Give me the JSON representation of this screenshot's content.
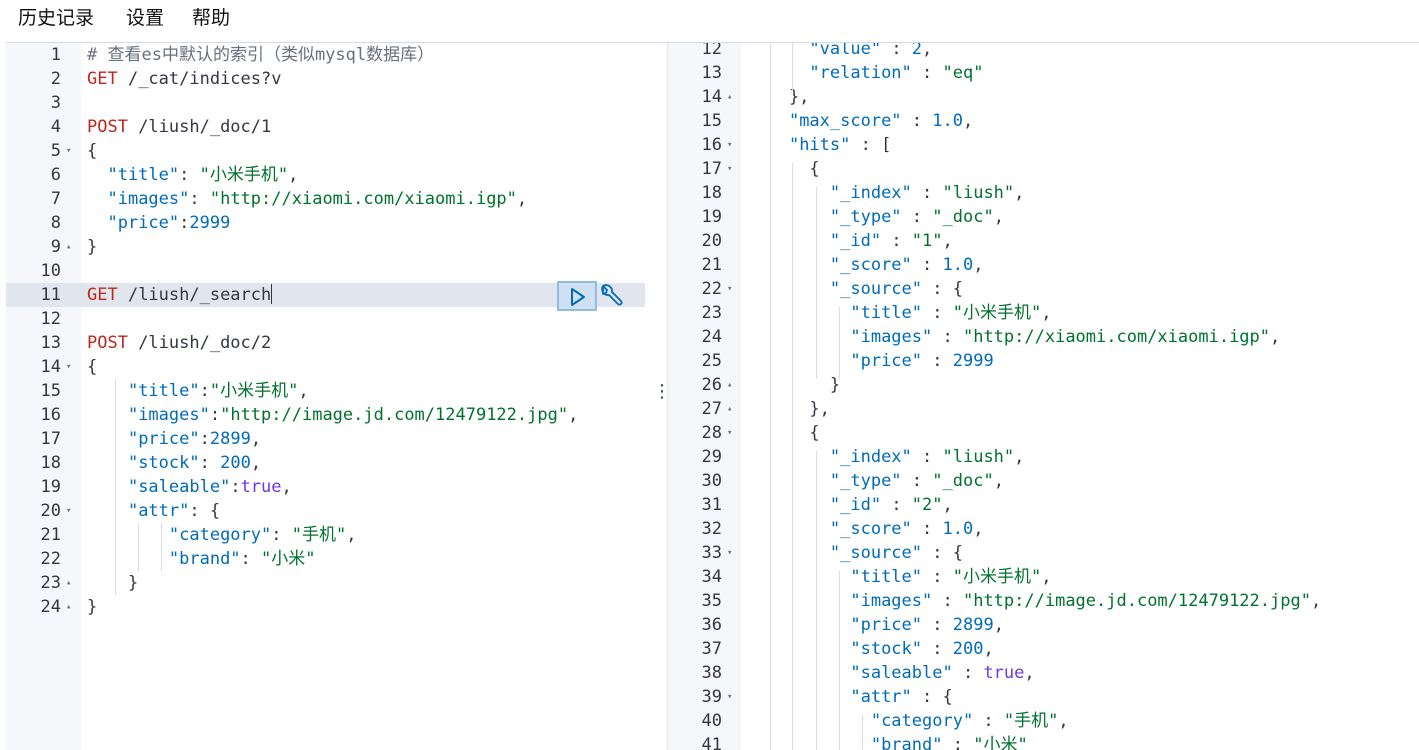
{
  "menu": [
    "历史记录",
    "设置",
    "帮助"
  ],
  "colors": {
    "string": "#00722d",
    "key": "#006bb8",
    "number": "#006bb8",
    "boolean": "#6e38e0",
    "method": "#bd271e",
    "comment": "#69707d",
    "gutter": "#f5f7fa",
    "active_line": "#e1e6ee"
  },
  "icons": {
    "run": "play-icon",
    "tools": "wrench-icon",
    "more": "kebab-menu-icon",
    "fold_open": "fold-open-icon",
    "fold_close": "fold-close-icon"
  },
  "request_editor": {
    "active_line": 11,
    "lines": [
      {
        "n": "1",
        "fold": "",
        "tokens": [
          [
            "c",
            "# 查看es中默认的索引（类似mysql数据库）"
          ]
        ]
      },
      {
        "n": "2",
        "fold": "",
        "tokens": [
          [
            "m",
            "GET"
          ],
          [
            "u",
            " /_cat/indices?v"
          ]
        ]
      },
      {
        "n": "3",
        "fold": "",
        "tokens": []
      },
      {
        "n": "4",
        "fold": "",
        "tokens": [
          [
            "m",
            "POST"
          ],
          [
            "u",
            " /liush/_doc/1"
          ]
        ]
      },
      {
        "n": "5",
        "fold": "▾",
        "tokens": [
          [
            "p",
            "{"
          ]
        ]
      },
      {
        "n": "6",
        "fold": "",
        "tokens": [
          [
            "p",
            "  "
          ],
          [
            "k",
            "\"title\""
          ],
          [
            "p",
            ": "
          ],
          [
            "s",
            "\"小米手机\""
          ],
          [
            "p",
            ","
          ]
        ]
      },
      {
        "n": "7",
        "fold": "",
        "tokens": [
          [
            "p",
            "  "
          ],
          [
            "k",
            "\"images\""
          ],
          [
            "p",
            ": "
          ],
          [
            "s",
            "\"http://xiaomi.com/xiaomi.igp\""
          ],
          [
            "p",
            ","
          ]
        ]
      },
      {
        "n": "8",
        "fold": "",
        "tokens": [
          [
            "p",
            "  "
          ],
          [
            "k",
            "\"price\""
          ],
          [
            "p",
            ":"
          ],
          [
            "n",
            "2999"
          ]
        ]
      },
      {
        "n": "9",
        "fold": "▴",
        "tokens": [
          [
            "p",
            "}"
          ]
        ]
      },
      {
        "n": "10",
        "fold": "",
        "tokens": []
      },
      {
        "n": "11",
        "fold": "",
        "tokens": [
          [
            "m",
            "GET"
          ],
          [
            "u",
            " /liush/_search"
          ]
        ]
      },
      {
        "n": "12",
        "fold": "",
        "tokens": []
      },
      {
        "n": "13",
        "fold": "",
        "tokens": [
          [
            "m",
            "POST"
          ],
          [
            "u",
            " /liush/_doc/2"
          ]
        ]
      },
      {
        "n": "14",
        "fold": "▾",
        "tokens": [
          [
            "p",
            "{"
          ]
        ]
      },
      {
        "n": "15",
        "fold": "",
        "tokens": [
          [
            "p",
            "    "
          ],
          [
            "k",
            "\"title\""
          ],
          [
            "p",
            ":"
          ],
          [
            "s",
            "\"小米手机\""
          ],
          [
            "p",
            ","
          ]
        ]
      },
      {
        "n": "16",
        "fold": "",
        "tokens": [
          [
            "p",
            "    "
          ],
          [
            "k",
            "\"images\""
          ],
          [
            "p",
            ":"
          ],
          [
            "s",
            "\"http://image.jd.com/12479122.jpg\""
          ],
          [
            "p",
            ","
          ]
        ]
      },
      {
        "n": "17",
        "fold": "",
        "tokens": [
          [
            "p",
            "    "
          ],
          [
            "k",
            "\"price\""
          ],
          [
            "p",
            ":"
          ],
          [
            "n",
            "2899"
          ],
          [
            "p",
            ","
          ]
        ]
      },
      {
        "n": "18",
        "fold": "",
        "tokens": [
          [
            "p",
            "    "
          ],
          [
            "k",
            "\"stock\""
          ],
          [
            "p",
            ": "
          ],
          [
            "n",
            "200"
          ],
          [
            "p",
            ","
          ]
        ]
      },
      {
        "n": "19",
        "fold": "",
        "tokens": [
          [
            "p",
            "    "
          ],
          [
            "k",
            "\"saleable\""
          ],
          [
            "p",
            ":"
          ],
          [
            "b",
            "true"
          ],
          [
            "p",
            ","
          ]
        ]
      },
      {
        "n": "20",
        "fold": "▾",
        "tokens": [
          [
            "p",
            "    "
          ],
          [
            "k",
            "\"attr\""
          ],
          [
            "p",
            ": {"
          ]
        ]
      },
      {
        "n": "21",
        "fold": "",
        "tokens": [
          [
            "p",
            "        "
          ],
          [
            "k",
            "\"category\""
          ],
          [
            "p",
            ": "
          ],
          [
            "s",
            "\"手机\""
          ],
          [
            "p",
            ","
          ]
        ]
      },
      {
        "n": "22",
        "fold": "",
        "tokens": [
          [
            "p",
            "        "
          ],
          [
            "k",
            "\"brand\""
          ],
          [
            "p",
            ": "
          ],
          [
            "s",
            "\"小米\""
          ]
        ]
      },
      {
        "n": "23",
        "fold": "▴",
        "tokens": [
          [
            "p",
            "    }"
          ]
        ]
      },
      {
        "n": "24",
        "fold": "▴",
        "tokens": [
          [
            "p",
            "}"
          ]
        ]
      }
    ]
  },
  "response_viewer": {
    "lines": [
      {
        "n": "12",
        "fold": "",
        "tokens": [
          [
            "p",
            "      "
          ],
          [
            "k",
            "\"value\""
          ],
          [
            "p",
            " : "
          ],
          [
            "n",
            "2"
          ],
          [
            "p",
            ","
          ]
        ]
      },
      {
        "n": "13",
        "fold": "",
        "tokens": [
          [
            "p",
            "      "
          ],
          [
            "k",
            "\"relation\""
          ],
          [
            "p",
            " : "
          ],
          [
            "s",
            "\"eq\""
          ]
        ]
      },
      {
        "n": "14",
        "fold": "▴",
        "tokens": [
          [
            "p",
            "    },"
          ]
        ]
      },
      {
        "n": "15",
        "fold": "",
        "tokens": [
          [
            "p",
            "    "
          ],
          [
            "k",
            "\"max_score\""
          ],
          [
            "p",
            " : "
          ],
          [
            "n",
            "1.0"
          ],
          [
            "p",
            ","
          ]
        ]
      },
      {
        "n": "16",
        "fold": "▾",
        "tokens": [
          [
            "p",
            "    "
          ],
          [
            "k",
            "\"hits\""
          ],
          [
            "p",
            " : ["
          ]
        ]
      },
      {
        "n": "17",
        "fold": "▾",
        "tokens": [
          [
            "p",
            "      {"
          ]
        ]
      },
      {
        "n": "18",
        "fold": "",
        "tokens": [
          [
            "p",
            "        "
          ],
          [
            "k",
            "\"_index\""
          ],
          [
            "p",
            " : "
          ],
          [
            "s",
            "\"liush\""
          ],
          [
            "p",
            ","
          ]
        ]
      },
      {
        "n": "19",
        "fold": "",
        "tokens": [
          [
            "p",
            "        "
          ],
          [
            "k",
            "\"_type\""
          ],
          [
            "p",
            " : "
          ],
          [
            "s",
            "\"_doc\""
          ],
          [
            "p",
            ","
          ]
        ]
      },
      {
        "n": "20",
        "fold": "",
        "tokens": [
          [
            "p",
            "        "
          ],
          [
            "k",
            "\"_id\""
          ],
          [
            "p",
            " : "
          ],
          [
            "s",
            "\"1\""
          ],
          [
            "p",
            ","
          ]
        ]
      },
      {
        "n": "21",
        "fold": "",
        "tokens": [
          [
            "p",
            "        "
          ],
          [
            "k",
            "\"_score\""
          ],
          [
            "p",
            " : "
          ],
          [
            "n",
            "1.0"
          ],
          [
            "p",
            ","
          ]
        ]
      },
      {
        "n": "22",
        "fold": "▾",
        "tokens": [
          [
            "p",
            "        "
          ],
          [
            "k",
            "\"_source\""
          ],
          [
            "p",
            " : {"
          ]
        ]
      },
      {
        "n": "23",
        "fold": "",
        "tokens": [
          [
            "p",
            "          "
          ],
          [
            "k",
            "\"title\""
          ],
          [
            "p",
            " : "
          ],
          [
            "s",
            "\"小米手机\""
          ],
          [
            "p",
            ","
          ]
        ]
      },
      {
        "n": "24",
        "fold": "",
        "tokens": [
          [
            "p",
            "          "
          ],
          [
            "k",
            "\"images\""
          ],
          [
            "p",
            " : "
          ],
          [
            "s",
            "\"http://xiaomi.com/xiaomi.igp\""
          ],
          [
            "p",
            ","
          ]
        ]
      },
      {
        "n": "25",
        "fold": "",
        "tokens": [
          [
            "p",
            "          "
          ],
          [
            "k",
            "\"price\""
          ],
          [
            "p",
            " : "
          ],
          [
            "n",
            "2999"
          ]
        ]
      },
      {
        "n": "26",
        "fold": "▴",
        "tokens": [
          [
            "p",
            "        }"
          ]
        ]
      },
      {
        "n": "27",
        "fold": "▴",
        "tokens": [
          [
            "p",
            "      },"
          ]
        ]
      },
      {
        "n": "28",
        "fold": "▾",
        "tokens": [
          [
            "p",
            "      {"
          ]
        ]
      },
      {
        "n": "29",
        "fold": "",
        "tokens": [
          [
            "p",
            "        "
          ],
          [
            "k",
            "\"_index\""
          ],
          [
            "p",
            " : "
          ],
          [
            "s",
            "\"liush\""
          ],
          [
            "p",
            ","
          ]
        ]
      },
      {
        "n": "30",
        "fold": "",
        "tokens": [
          [
            "p",
            "        "
          ],
          [
            "k",
            "\"_type\""
          ],
          [
            "p",
            " : "
          ],
          [
            "s",
            "\"_doc\""
          ],
          [
            "p",
            ","
          ]
        ]
      },
      {
        "n": "31",
        "fold": "",
        "tokens": [
          [
            "p",
            "        "
          ],
          [
            "k",
            "\"_id\""
          ],
          [
            "p",
            " : "
          ],
          [
            "s",
            "\"2\""
          ],
          [
            "p",
            ","
          ]
        ]
      },
      {
        "n": "32",
        "fold": "",
        "tokens": [
          [
            "p",
            "        "
          ],
          [
            "k",
            "\"_score\""
          ],
          [
            "p",
            " : "
          ],
          [
            "n",
            "1.0"
          ],
          [
            "p",
            ","
          ]
        ]
      },
      {
        "n": "33",
        "fold": "▾",
        "tokens": [
          [
            "p",
            "        "
          ],
          [
            "k",
            "\"_source\""
          ],
          [
            "p",
            " : {"
          ]
        ]
      },
      {
        "n": "34",
        "fold": "",
        "tokens": [
          [
            "p",
            "          "
          ],
          [
            "k",
            "\"title\""
          ],
          [
            "p",
            " : "
          ],
          [
            "s",
            "\"小米手机\""
          ],
          [
            "p",
            ","
          ]
        ]
      },
      {
        "n": "35",
        "fold": "",
        "tokens": [
          [
            "p",
            "          "
          ],
          [
            "k",
            "\"images\""
          ],
          [
            "p",
            " : "
          ],
          [
            "s",
            "\"http://image.jd.com/12479122.jpg\""
          ],
          [
            "p",
            ","
          ]
        ]
      },
      {
        "n": "36",
        "fold": "",
        "tokens": [
          [
            "p",
            "          "
          ],
          [
            "k",
            "\"price\""
          ],
          [
            "p",
            " : "
          ],
          [
            "n",
            "2899"
          ],
          [
            "p",
            ","
          ]
        ]
      },
      {
        "n": "37",
        "fold": "",
        "tokens": [
          [
            "p",
            "          "
          ],
          [
            "k",
            "\"stock\""
          ],
          [
            "p",
            " : "
          ],
          [
            "n",
            "200"
          ],
          [
            "p",
            ","
          ]
        ]
      },
      {
        "n": "38",
        "fold": "",
        "tokens": [
          [
            "p",
            "          "
          ],
          [
            "k",
            "\"saleable\""
          ],
          [
            "p",
            " : "
          ],
          [
            "b",
            "true"
          ],
          [
            "p",
            ","
          ]
        ]
      },
      {
        "n": "39",
        "fold": "▾",
        "tokens": [
          [
            "p",
            "          "
          ],
          [
            "k",
            "\"attr\""
          ],
          [
            "p",
            " : {"
          ]
        ]
      },
      {
        "n": "40",
        "fold": "",
        "tokens": [
          [
            "p",
            "            "
          ],
          [
            "k",
            "\"category\""
          ],
          [
            "p",
            " : "
          ],
          [
            "s",
            "\"手机\""
          ],
          [
            "p",
            ","
          ]
        ]
      },
      {
        "n": "41",
        "fold": "",
        "tokens": [
          [
            "p",
            "            "
          ],
          [
            "k",
            "\"brand\""
          ],
          [
            "p",
            " : "
          ],
          [
            "s",
            "\"小米\""
          ]
        ]
      }
    ]
  }
}
